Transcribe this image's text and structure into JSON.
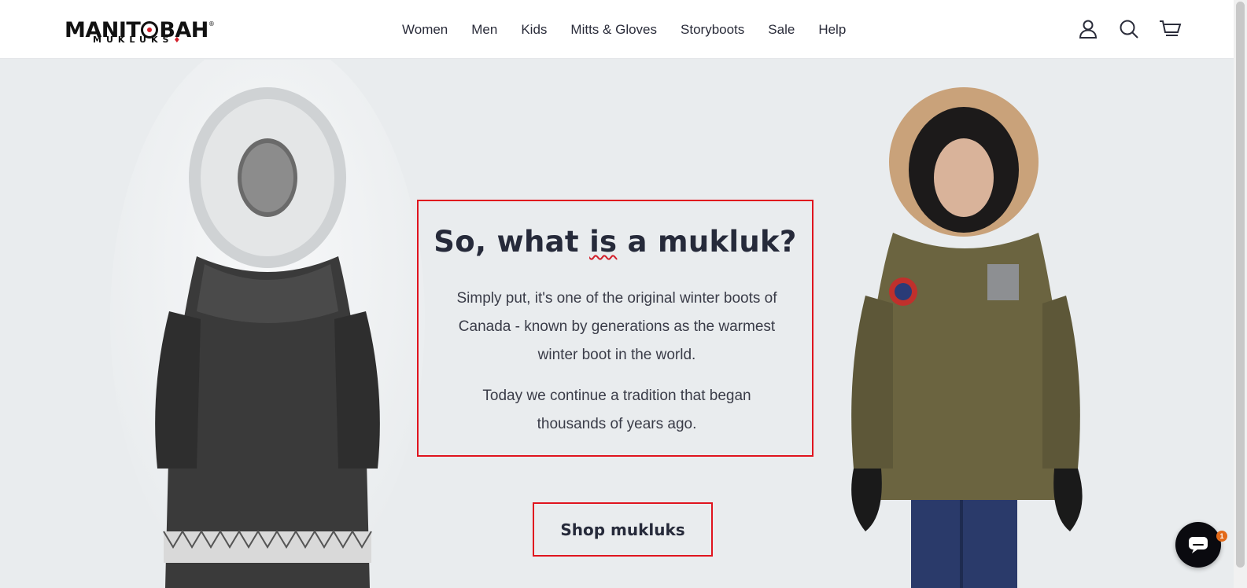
{
  "brand": {
    "logo_top_left": "MANIT",
    "logo_top_right": "BAH",
    "logo_tm": "®",
    "logo_bottom": "MUKLUKS",
    "logo_leaf": "♦"
  },
  "nav": {
    "items": [
      {
        "label": "Women"
      },
      {
        "label": "Men"
      },
      {
        "label": "Kids"
      },
      {
        "label": "Mitts & Gloves"
      },
      {
        "label": "Storyboots"
      },
      {
        "label": "Sale"
      },
      {
        "label": "Help"
      }
    ]
  },
  "header_icons": [
    "account-icon",
    "search-icon",
    "cart-icon"
  ],
  "hero": {
    "headline_before": "So, what ",
    "headline_emph": "is",
    "headline_after": " a mukluk?",
    "paragraph_1": "Simply put, it's one of the original winter boots of Canada - known by generations as the warmest winter boot in the world.",
    "paragraph_2": "Today we continue a tradition that began thousands of years ago.",
    "cta_label": "Shop mukluks"
  },
  "chat": {
    "badge_count": "1"
  },
  "colors": {
    "accent_red": "#e0141e",
    "background": "#e9ecee",
    "text_dark": "#262a3a"
  }
}
